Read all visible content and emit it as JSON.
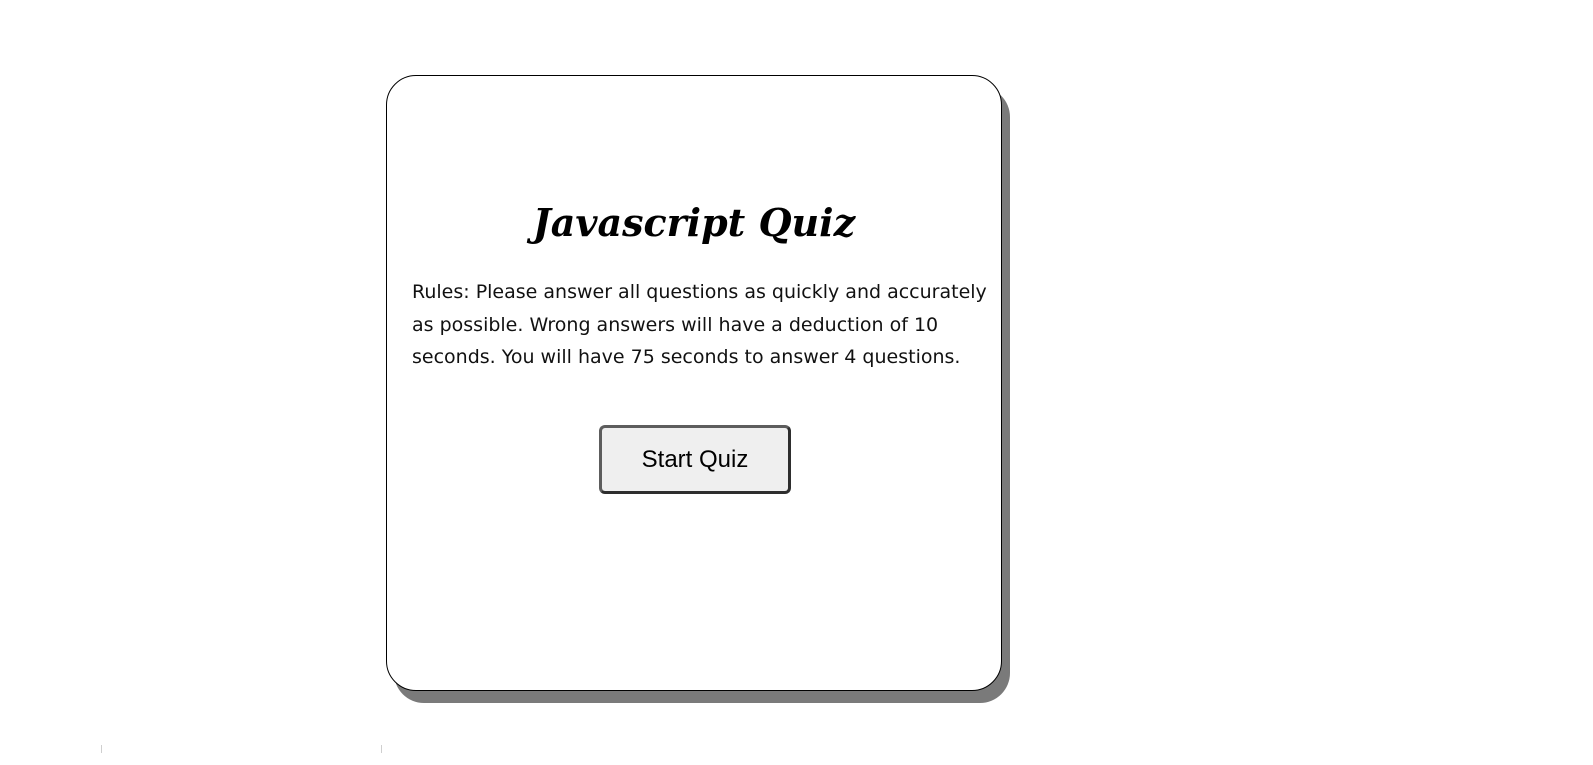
{
  "quiz": {
    "title": "Javascript Quiz",
    "rules_text": "Rules: Please answer all questions as quickly and accurately as possible. Wrong answers will have a deduction of 10 seconds. You will have 75 seconds to answer 4 questions.",
    "start_button_label": "Start Quiz"
  },
  "colors": {
    "background": "#ffffff",
    "card_border": "#000000",
    "card_shadow": "#7a7a7a",
    "button_background": "#efefef",
    "button_border": "#5d5d5d"
  }
}
